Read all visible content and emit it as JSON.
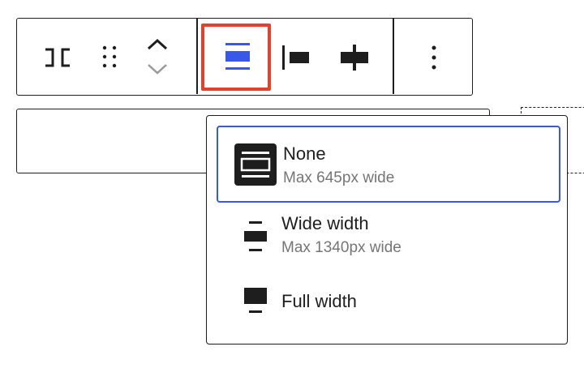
{
  "toolbar": {
    "highlight_color": "#e5402a",
    "accent_color": "#3858e9",
    "buttons": [
      {
        "name": "transform-block-icon"
      },
      {
        "name": "drag-handle-icon"
      },
      {
        "name": "move-up-chevron-icon"
      },
      {
        "name": "move-down-chevron-icon"
      },
      {
        "name": "align-none-icon"
      },
      {
        "name": "align-left-icon"
      },
      {
        "name": "align-center-icon"
      },
      {
        "name": "more-options-icon"
      }
    ]
  },
  "dropdown": {
    "options": [
      {
        "label": "None",
        "description": "Max 645px wide",
        "selected": true,
        "icon": "align-none-filled-icon"
      },
      {
        "label": "Wide width",
        "description": "Max 1340px wide",
        "selected": false,
        "icon": "align-wide-icon"
      },
      {
        "label": "Full width",
        "description": "",
        "selected": false,
        "icon": "align-full-icon"
      }
    ]
  }
}
